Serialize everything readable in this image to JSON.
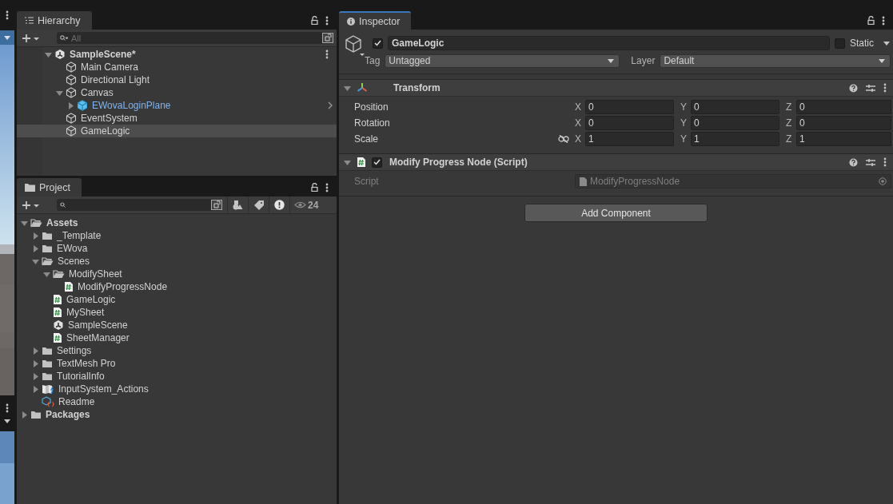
{
  "hierarchy": {
    "tab": "Hierarchy",
    "search_placeholder": "All",
    "tree": [
      {
        "label": "SampleScene*",
        "kind": "scene",
        "expanded": true,
        "selected": false,
        "children": [
          {
            "label": "Main Camera",
            "kind": "object",
            "selected": false
          },
          {
            "label": "Directional Light",
            "kind": "object",
            "selected": false
          },
          {
            "label": "Canvas",
            "kind": "object",
            "expanded": true,
            "selected": false,
            "children": [
              {
                "label": "EWovaLoginPlane",
                "kind": "prefab",
                "expanded": false,
                "selected": false
              }
            ]
          },
          {
            "label": "EventSystem",
            "kind": "object",
            "selected": false
          },
          {
            "label": "GameLogic",
            "kind": "object",
            "selected": true
          }
        ]
      }
    ]
  },
  "project": {
    "tab": "Project",
    "hidden_count": "24",
    "tree": [
      {
        "label": "Assets",
        "kind": "folder",
        "expanded": true,
        "selected": false,
        "children": [
          {
            "label": "_Template",
            "kind": "folder",
            "expanded": false,
            "selected": false
          },
          {
            "label": "EWova",
            "kind": "folder",
            "expanded": false,
            "selected": false
          },
          {
            "label": "Scenes",
            "kind": "folder",
            "expanded": true,
            "selected": false,
            "children": [
              {
                "label": "ModifySheet",
                "kind": "folder",
                "expanded": true,
                "selected": false,
                "children": [
                  {
                    "label": "ModifyProgressNode",
                    "kind": "script",
                    "selected": false
                  }
                ]
              },
              {
                "label": "GameLogic",
                "kind": "script",
                "selected": false
              },
              {
                "label": "MySheet",
                "kind": "script",
                "selected": false
              },
              {
                "label": "SampleScene",
                "kind": "scene",
                "selected": false
              },
              {
                "label": "SheetManager",
                "kind": "script",
                "selected": false
              }
            ]
          },
          {
            "label": "Settings",
            "kind": "folder",
            "expanded": false,
            "selected": false
          },
          {
            "label": "TextMesh Pro",
            "kind": "folder",
            "expanded": false,
            "selected": false
          },
          {
            "label": "TutorialInfo",
            "kind": "folder",
            "expanded": false,
            "selected": false
          },
          {
            "label": "InputSystem_Actions",
            "kind": "actions",
            "expanded": false,
            "selected": false
          },
          {
            "label": "Readme",
            "kind": "readme",
            "selected": false
          }
        ]
      },
      {
        "label": "Packages",
        "kind": "folder",
        "expanded": false,
        "selected": false
      }
    ]
  },
  "inspector": {
    "tab": "Inspector",
    "name": "GameLogic",
    "active": true,
    "static": false,
    "static_label": "Static",
    "tag_label": "Tag",
    "tag": "Untagged",
    "layer_label": "Layer",
    "layer": "Default",
    "components": [
      {
        "kind": "transform",
        "title": "Transform",
        "expanded": true,
        "rows": [
          {
            "label": "Position",
            "linked": null,
            "fields": [
              {
                "axis": "X",
                "value": "0"
              },
              {
                "axis": "Y",
                "value": "0"
              },
              {
                "axis": "Z",
                "value": "0"
              }
            ]
          },
          {
            "label": "Rotation",
            "linked": null,
            "fields": [
              {
                "axis": "X",
                "value": "0"
              },
              {
                "axis": "Y",
                "value": "0"
              },
              {
                "axis": "Z",
                "value": "0"
              }
            ]
          },
          {
            "label": "Scale",
            "linked": false,
            "fields": [
              {
                "axis": "X",
                "value": "1"
              },
              {
                "axis": "Y",
                "value": "1"
              },
              {
                "axis": "Z",
                "value": "1"
              }
            ]
          }
        ]
      },
      {
        "kind": "script",
        "title": "Modify Progress Node (Script)",
        "expanded": true,
        "enabled": true,
        "properties": [
          {
            "label": "Script",
            "value": "ModifyProgressNode",
            "disabled": true
          }
        ]
      }
    ],
    "add_button": "Add Component"
  }
}
